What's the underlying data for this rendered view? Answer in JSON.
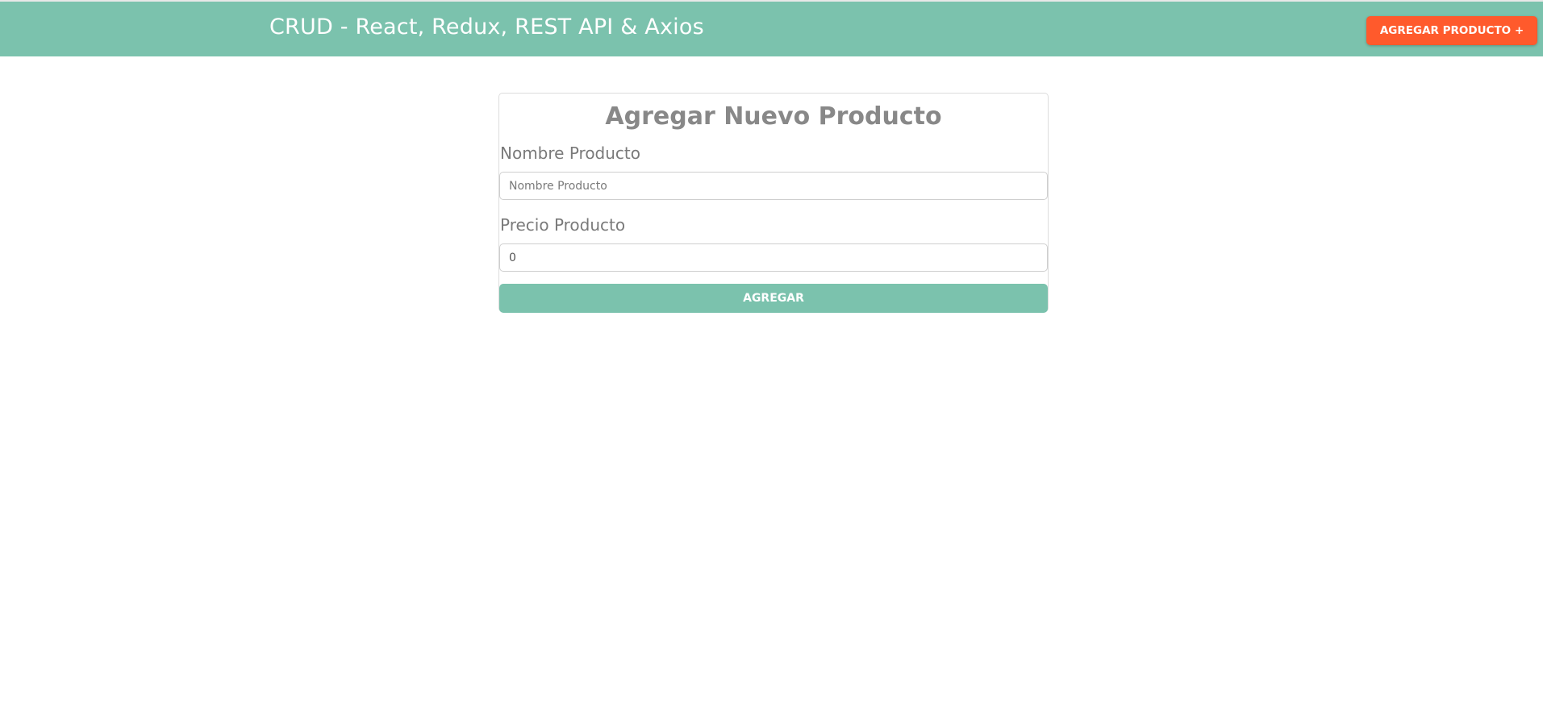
{
  "navbar": {
    "title": "CRUD - React, Redux, REST API & Axios",
    "add_button_label": "Agregar Producto +",
    "background_color": "#7bc2ad",
    "button_color": "#ff5a2c"
  },
  "form": {
    "title": "Agregar Nuevo Producto",
    "name_label": "Nombre Producto",
    "name_placeholder": "Nombre Producto",
    "name_value": "",
    "price_label": "Precio Producto",
    "price_value": "0",
    "submit_label": "Agregar",
    "submit_color": "#7bc2ad"
  }
}
